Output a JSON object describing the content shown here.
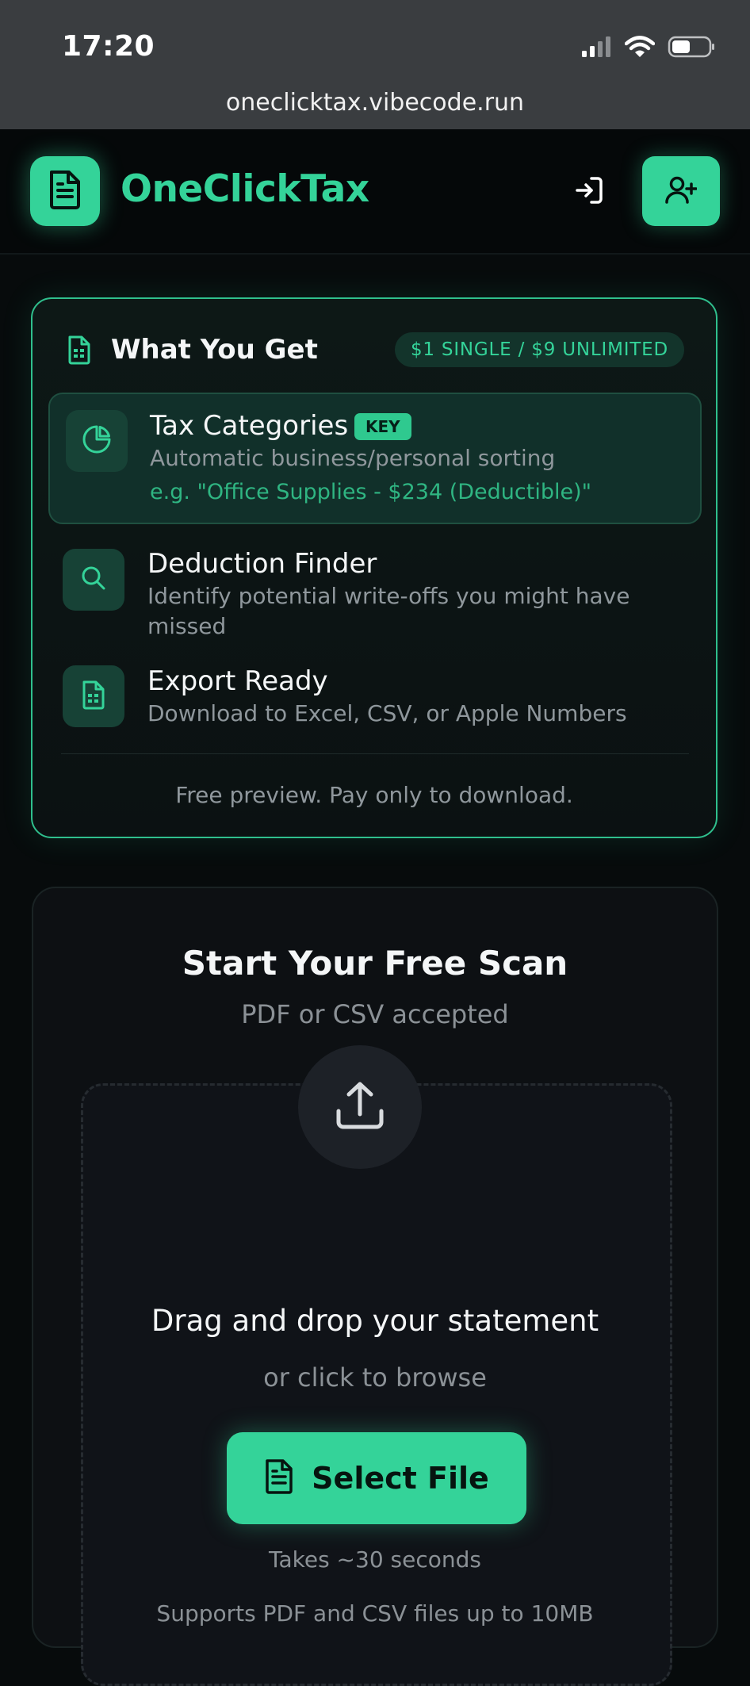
{
  "status_bar": {
    "time": "17:20",
    "url": "oneclicktax.vibecode.run",
    "icons": [
      "cellular-signal-icon",
      "wifi-icon",
      "battery-icon"
    ]
  },
  "header": {
    "brand": "OneClickTax",
    "logo_icon": "document-icon",
    "login_icon": "sign-in-icon",
    "signup_icon": "user-plus-icon"
  },
  "what_you_get": {
    "title": "What You Get",
    "price_badge": "$1 SINGLE / $9 UNLIMITED",
    "features": [
      {
        "title": "Tax Categories",
        "badge": "KEY",
        "description": "Automatic business/personal sorting",
        "example": "e.g. \"Office Supplies - $234 (Deductible)\"",
        "icon": "pie-chart-icon"
      },
      {
        "title": "Deduction Finder",
        "description_line1": "Identify potential write-offs you might have",
        "description_line2": "missed",
        "icon": "search-icon"
      },
      {
        "title": "Export Ready",
        "description": "Download to Excel, CSV, or Apple Numbers",
        "icon": "spreadsheet-icon"
      }
    ],
    "footer": "Free preview. Pay only to download."
  },
  "scan": {
    "title": "Start Your Free Scan",
    "subtitle": "PDF or CSV accepted",
    "drop_title": "Drag and drop your statement",
    "drop_subtitle": "or click to browse",
    "button_label": "Select File",
    "takes": "Takes ~30 seconds",
    "supports": "Supports PDF and CSV files up to 10MB"
  },
  "colors": {
    "accent": "#34d399",
    "background": "#070b0c",
    "card": "#0d1013"
  }
}
